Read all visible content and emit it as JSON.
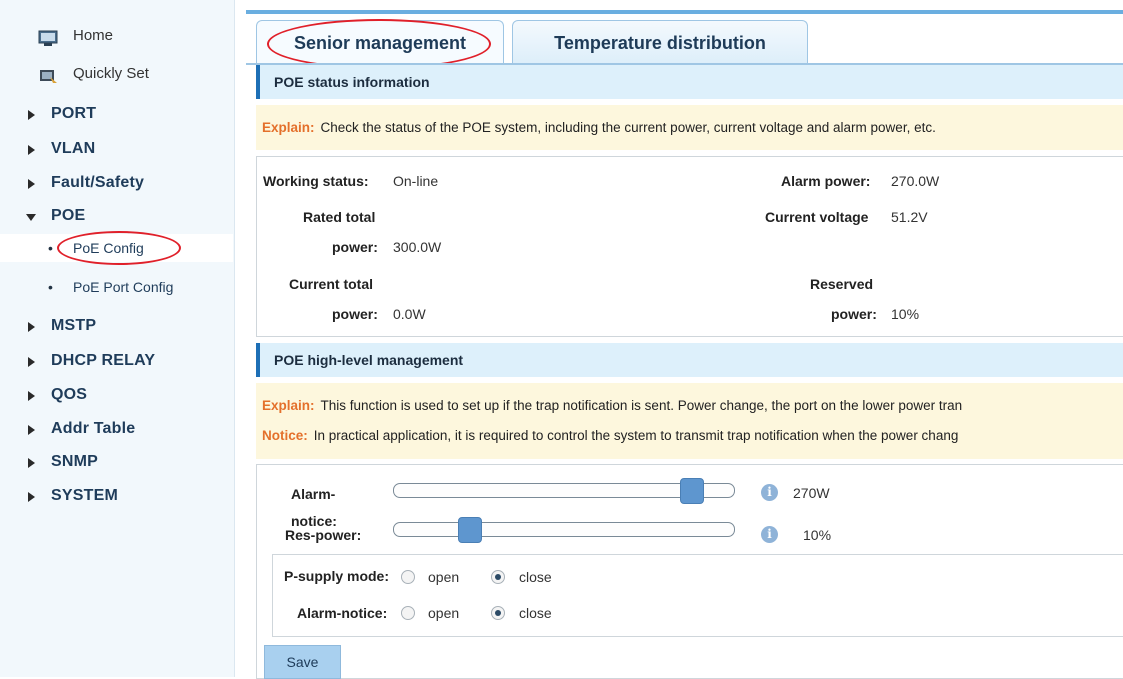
{
  "sidebar": {
    "home": "Home",
    "quickly_set": "Quickly Set",
    "categories": [
      "PORT",
      "VLAN",
      "Fault/Safety",
      "POE",
      "MSTP",
      "DHCP RELAY",
      "QOS",
      "Addr Table",
      "SNMP",
      "SYSTEM"
    ],
    "poe_sub": [
      "PoE Config",
      "PoE Port Config"
    ]
  },
  "tabs": [
    "Senior management",
    "Temperature distribution"
  ],
  "status_section": {
    "title": "POE status information",
    "explain_key": "Explain:",
    "explain_text": "Check the status of the POE system, including the current power, current voltage and alarm power, etc.",
    "working_status_label": "Working status:",
    "working_status_value": "On-line",
    "rated_total_label1": "Rated total",
    "rated_total_label2": "power:",
    "rated_total_value": "300.0W",
    "current_total_label1": "Current total",
    "current_total_label2": "power:",
    "current_total_value": "0.0W",
    "alarm_power_label": "Alarm power:",
    "alarm_power_value": "270.0W",
    "current_voltage_label": "Current voltage",
    "current_voltage_value": "51.2V",
    "reserved_label1": "Reserved",
    "reserved_label2": "power:",
    "reserved_value": "10%"
  },
  "mgmt_section": {
    "title": "POE high-level management",
    "explain_key": "Explain:",
    "explain_text": "This function is used to set up if the trap notification is sent. Power change, the port on the lower power tran",
    "notice_key": "Notice:",
    "notice_text": "In practical application, it is required to control the system to transmit trap notification when the power chang",
    "alarm_notice_label1": "Alarm-",
    "alarm_notice_label2": "notice:",
    "alarm_notice_value": "270W",
    "alarm_notice_fraction": 0.9,
    "res_power_label": "Res-power:",
    "res_power_value": "10%",
    "res_power_fraction": 0.2,
    "psupply_label": "P-supply mode:",
    "alarm_mode_label": "Alarm-notice:",
    "open_label": "open",
    "close_label": "close",
    "psupply_selected": "close",
    "alarm_selected": "close",
    "save_label": "Save"
  },
  "colors": {
    "accent": "#1d6fb6",
    "explain_key": "#e4702b",
    "annotation_oval": "#e0202a",
    "section_bg": "#ddf0fb",
    "explain_bg": "#fdf7dd"
  },
  "icons": [
    "home-icon",
    "quickly-set-icon",
    "info-icon"
  ]
}
